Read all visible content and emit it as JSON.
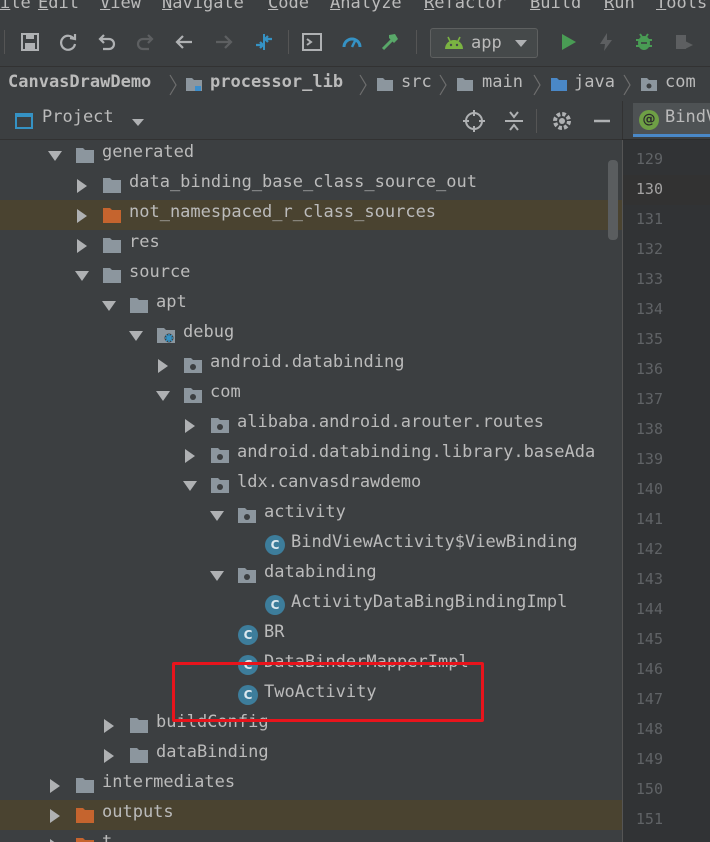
{
  "menu": [
    "ile",
    "Edit",
    "View",
    "Navigate",
    "Code",
    "Analyze",
    "Refactor",
    "Build",
    "Run",
    "Tools"
  ],
  "toolbar": {
    "run_config": "app"
  },
  "breadcrumb": [
    "CanvasDrawDemo",
    "processor_lib",
    "src",
    "main",
    "java",
    "com"
  ],
  "project_panel": {
    "title": "Project"
  },
  "editor": {
    "tab_label": "BindV"
  },
  "tree": [
    {
      "label": "generated",
      "indent": 1,
      "arrow": "down",
      "icon": "folder"
    },
    {
      "label": "data_binding_base_class_source_out",
      "indent": 2,
      "arrow": "right",
      "icon": "folder"
    },
    {
      "label": "not_namespaced_r_class_sources",
      "indent": 2,
      "arrow": "right",
      "icon": "folder-orange",
      "selected": true
    },
    {
      "label": "res",
      "indent": 2,
      "arrow": "right",
      "icon": "folder"
    },
    {
      "label": "source",
      "indent": 2,
      "arrow": "down",
      "icon": "folder"
    },
    {
      "label": "apt",
      "indent": 3,
      "arrow": "down",
      "icon": "folder"
    },
    {
      "label": "debug",
      "indent": 4,
      "arrow": "down",
      "icon": "folder-gen"
    },
    {
      "label": "android.databinding",
      "indent": 5,
      "arrow": "right",
      "icon": "package"
    },
    {
      "label": "com",
      "indent": 5,
      "arrow": "down",
      "icon": "package"
    },
    {
      "label": "alibaba.android.arouter.routes",
      "indent": 6,
      "arrow": "right",
      "icon": "package"
    },
    {
      "label": "android.databinding.library.baseAda",
      "indent": 6,
      "arrow": "right",
      "icon": "package"
    },
    {
      "label": "ldx.canvasdrawdemo",
      "indent": 6,
      "arrow": "down",
      "icon": "package"
    },
    {
      "label": "activity",
      "indent": 7,
      "arrow": "down",
      "icon": "package"
    },
    {
      "label": "BindViewActivity$ViewBinding",
      "indent": 8,
      "arrow": "none",
      "icon": "class"
    },
    {
      "label": "databinding",
      "indent": 7,
      "arrow": "down",
      "icon": "package"
    },
    {
      "label": "ActivityDataBingBindingImpl",
      "indent": 8,
      "arrow": "none",
      "icon": "class"
    },
    {
      "label": "BR",
      "indent": 7,
      "arrow": "none",
      "icon": "class"
    },
    {
      "label": "DataBinderMapperImpl",
      "indent": 7,
      "arrow": "none",
      "icon": "class"
    },
    {
      "label": "TwoActivity",
      "indent": 7,
      "arrow": "none",
      "icon": "class"
    },
    {
      "label": "buildConfig",
      "indent": 3,
      "arrow": "right",
      "icon": "folder"
    },
    {
      "label": "dataBinding",
      "indent": 3,
      "arrow": "right",
      "icon": "folder"
    },
    {
      "label": "intermediates",
      "indent": 1,
      "arrow": "right",
      "icon": "folder"
    },
    {
      "label": "outputs",
      "indent": 1,
      "arrow": "right",
      "icon": "folder-orange",
      "selected": true
    },
    {
      "label": "t",
      "indent": 1,
      "arrow": "right",
      "icon": "folder-orange"
    }
  ],
  "line_numbers": [
    "129",
    "130",
    "131",
    "132",
    "133",
    "134",
    "135",
    "136",
    "137",
    "138",
    "139",
    "140",
    "141",
    "142",
    "143",
    "144",
    "145",
    "146",
    "147",
    "148",
    "149",
    "150",
    "151"
  ],
  "current_line": "130",
  "colors": {
    "folder": "#8c969e",
    "folder_orange": "#c5642e",
    "class_icon": "#3d7d9b",
    "highlight_box": "#e8141c"
  }
}
